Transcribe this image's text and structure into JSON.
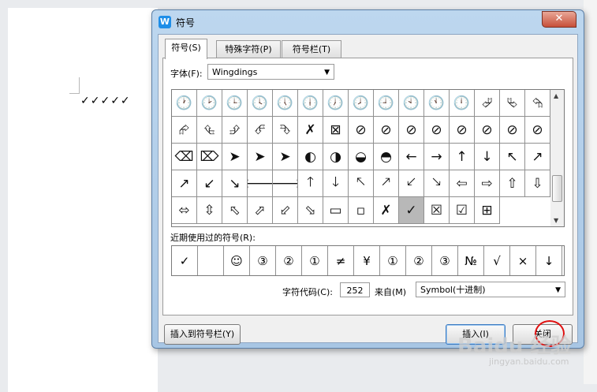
{
  "document": {
    "content": "✓✓✓✓✓"
  },
  "watermark": {
    "text": "Baidu 经验",
    "url": "jingyan.baidu.com"
  },
  "dialog": {
    "app_icon": "W",
    "title": "符号",
    "close_glyph": "✕",
    "tabs": [
      {
        "label": "符号(S)",
        "active": true
      },
      {
        "label": "特殊字符(P)",
        "active": false
      },
      {
        "label": "符号栏(T)",
        "active": false
      }
    ],
    "font": {
      "label": "字体(F):",
      "value": "Wingdings",
      "caret": "▼"
    },
    "symbol_grid": {
      "rows": [
        [
          "🕐",
          "🕑",
          "🕒",
          "🕓",
          "🕔",
          "🕕",
          "🕖",
          "🕗",
          "🕘",
          "🕙",
          "🕚",
          "🕛",
          "⮰",
          "⮱",
          "⮲"
        ],
        [
          "⮳",
          "⮴",
          "⮵",
          "⮶",
          "⮷",
          "✗",
          "⊠",
          "⊘",
          "⊘",
          "⊘",
          "⊘",
          "⊘",
          "⊘",
          "⊘",
          "⊘"
        ],
        [
          "⌫",
          "⌦",
          "➤",
          "➤",
          "➤",
          "◐",
          "◑",
          "◒",
          "◓",
          "←",
          "→",
          "↑",
          "↓",
          "↖",
          "↗"
        ],
        [
          "↗",
          "↙",
          "↘",
          "🡐",
          "🡒",
          "🡑",
          "🡓",
          "🡔",
          "🡕",
          "🡗",
          "🡖",
          "⇦",
          "⇨",
          "⇧",
          "⇩"
        ],
        [
          "⬄",
          "⇳",
          "⬁",
          "⬀",
          "⬃",
          "⬂",
          "▭",
          "▫",
          "✗",
          "✓",
          "☒",
          "☑",
          "⊞"
        ]
      ],
      "selected": {
        "row": 4,
        "col": 9
      }
    },
    "scrollbar": {
      "up": "▲",
      "down": "▼"
    },
    "recent": {
      "label": "近期使用过的符号(R):",
      "symbols": [
        "✓",
        "",
        "☺",
        "③",
        "②",
        "①",
        "≠",
        "¥",
        "①",
        "②",
        "③",
        "№",
        "√",
        "×",
        "↓"
      ]
    },
    "char_code": {
      "label": "字符代码(C):",
      "value": "252"
    },
    "from": {
      "label": "来自(M)",
      "value": "Symbol(十进制)",
      "caret": "▼"
    },
    "buttons": {
      "insert_to_bar": "插入到符号栏(Y)",
      "insert": "插入(I)",
      "close": "关闭"
    },
    "colors": {
      "titlebar": "#bdd7ef",
      "close_x": "#c7503a",
      "highlight_circle": "#e01010"
    }
  }
}
